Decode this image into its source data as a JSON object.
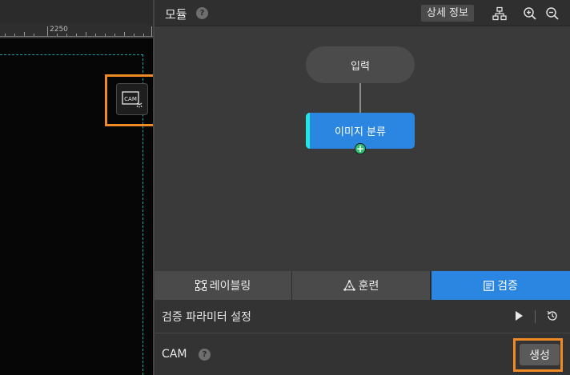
{
  "ruler": {
    "label": "2250"
  },
  "canvas_tool": {
    "cam_label": "CAM"
  },
  "header": {
    "title": "모듈",
    "help": "?",
    "details_label": "상세 정보"
  },
  "graph": {
    "input_node": "입력",
    "classify_node": "이미지 분류",
    "add_symbol": "+"
  },
  "tabs": [
    {
      "label": "레이블링",
      "icon": "labeling-icon"
    },
    {
      "label": "훈련",
      "icon": "training-icon"
    },
    {
      "label": "검증",
      "icon": "validation-icon",
      "active": true
    }
  ],
  "validation": {
    "param_title": "검증 파라미터 설정",
    "cam_label": "CAM",
    "help": "?",
    "generate_label": "생성"
  },
  "colors": {
    "accent_blue": "#2a86e0",
    "highlight_orange": "#f08a24",
    "node_accent": "#23e6e0",
    "dashed_border": "#1aa3a3"
  }
}
